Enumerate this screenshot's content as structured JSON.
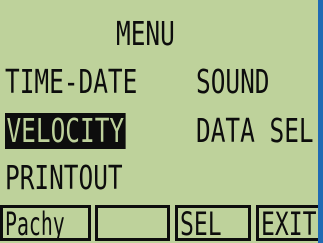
{
  "menu": {
    "title": "MENU",
    "items": [
      {
        "label": "TIME-DATE"
      },
      {
        "label": "SOUND"
      },
      {
        "label": "VELOCITY",
        "selected": true
      },
      {
        "label": "DATA SEL"
      },
      {
        "label": "PRINTOUT"
      }
    ]
  },
  "softkeys": [
    {
      "label": "Pachy"
    },
    {
      "label": ""
    },
    {
      "label": "SEL"
    },
    {
      "label": "EXIT"
    }
  ],
  "colors": {
    "lcd_background": "#bed29b",
    "lcd_text": "#0d0d0d",
    "bezel": "#1f6bb4"
  }
}
